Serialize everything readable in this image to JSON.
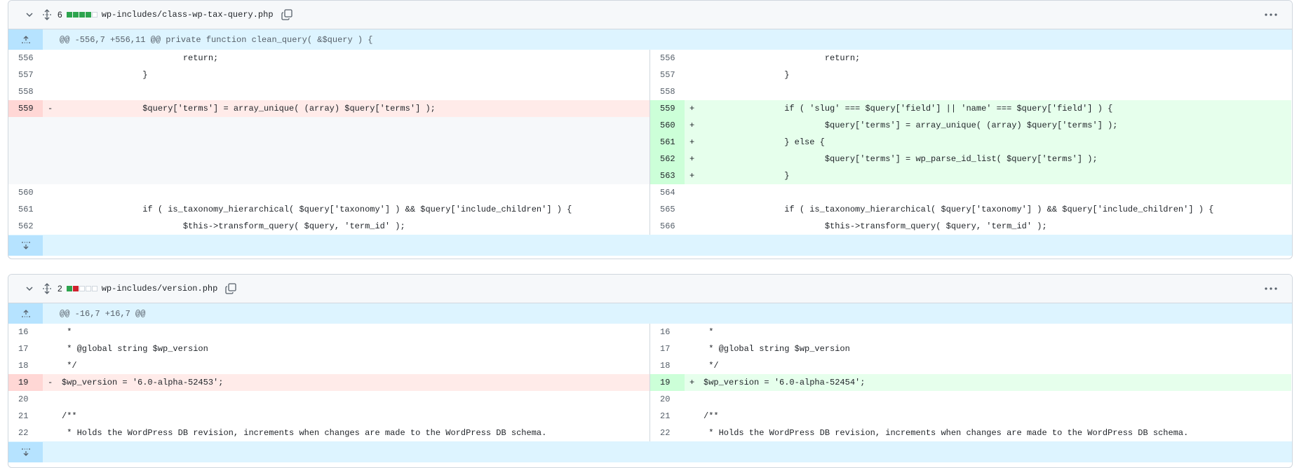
{
  "files": [
    {
      "changes": "6",
      "name": "wp-includes/class-wp-tax-query.php",
      "hunk_header": "@@ -556,7 +556,11 @@ private function clean_query( &$query ) {",
      "rows": [
        {
          "l_ln": "556",
          "l_code": "                        return;",
          "r_ln": "556",
          "r_code": "                        return;",
          "type": "ctx"
        },
        {
          "l_ln": "557",
          "l_code": "                }",
          "r_ln": "557",
          "r_code": "                }",
          "type": "ctx"
        },
        {
          "l_ln": "558",
          "l_code": "",
          "r_ln": "558",
          "r_code": "",
          "type": "ctx"
        },
        {
          "l_ln": "559",
          "l_code": "                $query['terms'] = array_unique( (array) $query['terms'] );",
          "r_ln": "559",
          "r_code": "                if ( 'slug' === $query['field'] || 'name' === $query['field'] ) {",
          "type": "change"
        },
        {
          "l_ln": "",
          "l_code": "",
          "r_ln": "560",
          "r_code": "                        $query['terms'] = array_unique( (array) $query['terms'] );",
          "type": "addonly"
        },
        {
          "l_ln": "",
          "l_code": "",
          "r_ln": "561",
          "r_code": "                } else {",
          "type": "addonly"
        },
        {
          "l_ln": "",
          "l_code": "",
          "r_ln": "562",
          "r_code": "                        $query['terms'] = wp_parse_id_list( $query['terms'] );",
          "type": "addonly"
        },
        {
          "l_ln": "",
          "l_code": "",
          "r_ln": "563",
          "r_code": "                }",
          "type": "addonly"
        },
        {
          "l_ln": "560",
          "l_code": "",
          "r_ln": "564",
          "r_code": "",
          "type": "ctx"
        },
        {
          "l_ln": "561",
          "l_code": "                if ( is_taxonomy_hierarchical( $query['taxonomy'] ) && $query['include_children'] ) {",
          "r_ln": "565",
          "r_code": "                if ( is_taxonomy_hierarchical( $query['taxonomy'] ) && $query['include_children'] ) {",
          "type": "ctx"
        },
        {
          "l_ln": "562",
          "l_code": "                        $this->transform_query( $query, 'term_id' );",
          "r_ln": "566",
          "r_code": "                        $this->transform_query( $query, 'term_id' );",
          "type": "ctx"
        }
      ]
    },
    {
      "changes": "2",
      "name": "wp-includes/version.php",
      "hunk_header": "@@ -16,7 +16,7 @@",
      "rows": [
        {
          "l_ln": "16",
          "l_code": " *",
          "r_ln": "16",
          "r_code": " *",
          "type": "ctx"
        },
        {
          "l_ln": "17",
          "l_code": " * @global string $wp_version",
          "r_ln": "17",
          "r_code": " * @global string $wp_version",
          "type": "ctx"
        },
        {
          "l_ln": "18",
          "l_code": " */",
          "r_ln": "18",
          "r_code": " */",
          "type": "ctx"
        },
        {
          "l_ln": "19",
          "l_code": "$wp_version = '6.0-alpha-52453';",
          "r_ln": "19",
          "r_code": "$wp_version = '6.0-alpha-52454';",
          "type": "change"
        },
        {
          "l_ln": "20",
          "l_code": "",
          "r_ln": "20",
          "r_code": "",
          "type": "ctx"
        },
        {
          "l_ln": "21",
          "l_code": "/**",
          "r_ln": "21",
          "r_code": "/**",
          "type": "ctx"
        },
        {
          "l_ln": "22",
          "l_code": " * Holds the WordPress DB revision, increments when changes are made to the WordPress DB schema.",
          "r_ln": "22",
          "r_code": " * Holds the WordPress DB revision, increments when changes are made to the WordPress DB schema.",
          "type": "ctx"
        }
      ]
    }
  ],
  "icons": {
    "collapse": "chevron-down-icon",
    "expand_all": "unfold-icon",
    "copy": "copy-icon",
    "more": "kebab-horizontal-icon",
    "expand_up": "fold-up-icon",
    "expand_down": "fold-down-icon"
  },
  "colors": {
    "deletion_bg": "#ffebe9",
    "addition_bg": "#e6ffec",
    "hunk_bg": "#ddf4ff",
    "diffstat_add": "#2da44e",
    "diffstat_del": "#cf222e"
  }
}
